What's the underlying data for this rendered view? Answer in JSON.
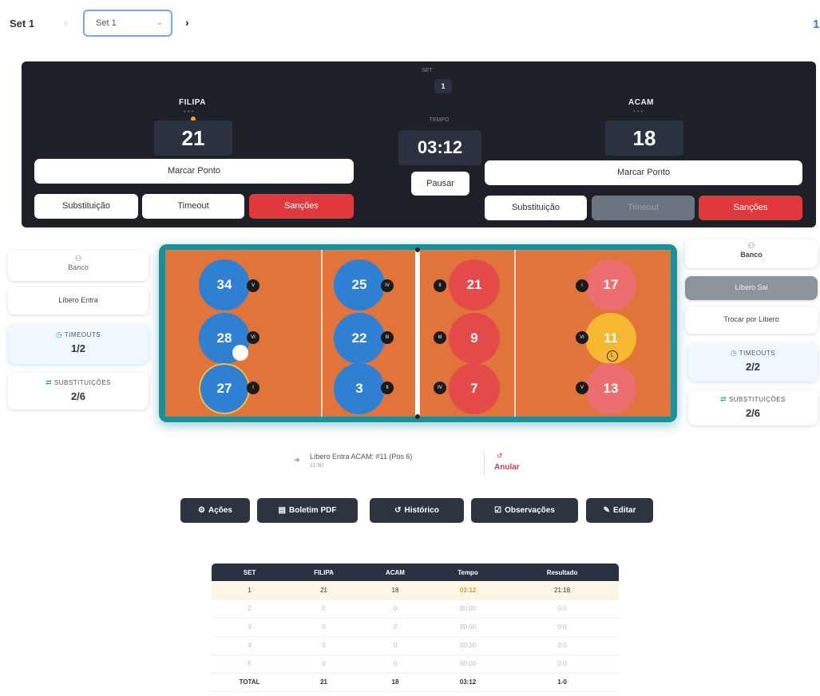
{
  "topbar": {
    "set_label": "Set 1",
    "prev_icon": "chevron-left",
    "select_value": "Set 1",
    "next_icon": "chevron-right",
    "right_number": "1"
  },
  "scoreboard": {
    "set_caption": "SET",
    "set_number": "1",
    "time_caption": "TEMPO",
    "time": "03:12",
    "pause_label": "Pausar",
    "home": {
      "name": "FILIPA",
      "score": "21",
      "mark_point_label": "Marcar Ponto",
      "substitution_label": "Substituição",
      "timeout_label": "Timeout",
      "sanctions_label": "Sanções"
    },
    "away": {
      "name": "ACAM",
      "score": "18",
      "mark_point_label": "Marcar Ponto",
      "substitution_label": "Substituição",
      "timeout_label": "Timeout",
      "sanctions_label": "Sanções"
    }
  },
  "left_panel": {
    "bench_label": "Banco",
    "libero_label": "Líbero Entra",
    "timeouts_title": "TIMEOUTS",
    "timeouts_value": "1/2",
    "subs_title": "SUBSTITUIÇÕES",
    "subs_value": "2/6"
  },
  "right_panel": {
    "bench_label": "Banco",
    "libero_out_label": "Líbero Sai",
    "swap_libero_label": "Trocar por Líbero",
    "timeouts_title": "TIMEOUTS",
    "timeouts_value": "2/2",
    "subs_title": "SUBSTITUIÇÕES",
    "subs_value": "2/6"
  },
  "court": {
    "home_players": [
      {
        "number": "34",
        "position": "V"
      },
      {
        "number": "28",
        "position": "VI"
      },
      {
        "number": "27",
        "position": "I"
      },
      {
        "number": "25",
        "position": "IV"
      },
      {
        "number": "22",
        "position": "III"
      },
      {
        "number": "3",
        "position": "II"
      }
    ],
    "away_players": [
      {
        "number": "21",
        "position": "II"
      },
      {
        "number": "9",
        "position": "III"
      },
      {
        "number": "7",
        "position": "IV"
      },
      {
        "number": "17",
        "position": "I"
      },
      {
        "number": "11",
        "position": "VI"
      },
      {
        "number": "13",
        "position": "V"
      }
    ],
    "libero_marker": "L",
    "colors": {
      "home": "#2f7fd2",
      "away": "#e54a4a",
      "libero": "#f7b731",
      "court": "#e0743a",
      "frame": "#1d8f96"
    }
  },
  "last_action": {
    "text": "Líbero Entra ACAM: #11 (Pos 6)",
    "time": "11:50",
    "undo_label": "Anular"
  },
  "actions": {
    "acoes": "Ações",
    "boletim": "Boletim PDF",
    "historico": "Histórico",
    "observacoes": "Observações",
    "editar": "Editar"
  },
  "table": {
    "headers": [
      "SET",
      "FILIPA",
      "ACAM",
      "Tempo",
      "Resultado"
    ],
    "rows": [
      [
        "1",
        "21",
        "18",
        "03:12",
        "21:18"
      ],
      [
        "2",
        "0",
        "0",
        "00:00",
        "0:0"
      ],
      [
        "3",
        "0",
        "0",
        "00:00",
        "0:0"
      ],
      [
        "4",
        "0",
        "0",
        "00:00",
        "0:0"
      ],
      [
        "5",
        "0",
        "0",
        "00:00",
        "0:0"
      ]
    ],
    "total": [
      "TOTAL",
      "21",
      "18",
      "03:12",
      "1-0"
    ]
  }
}
